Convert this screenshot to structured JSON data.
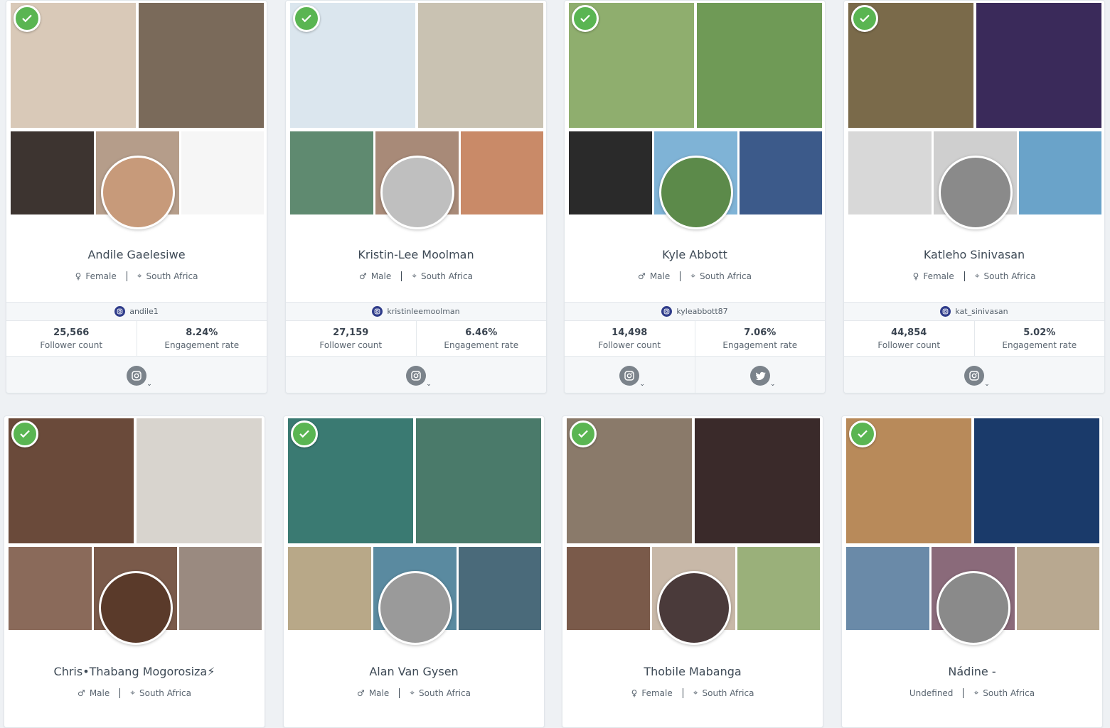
{
  "cards": [
    {
      "name": "Andile Gaelesiwe",
      "gender": "Female",
      "country": "South Africa",
      "handle": "andile1",
      "followers": "25,566",
      "follower_label": "Follower count",
      "engagement": "8.24%",
      "engagement_label": "Engagement rate",
      "socials": [
        "instagram-icon"
      ],
      "avatar_color": "#c79a7a",
      "photo_colors": [
        "#d9c9b8",
        "#7a6a5a",
        "#3d3430",
        "#b59d8a",
        "#f6f6f6"
      ]
    },
    {
      "name": "Kristin-Lee Moolman",
      "gender": "Male",
      "country": "South Africa",
      "handle": "kristinleemoolman",
      "followers": "27,159",
      "follower_label": "Follower count",
      "engagement": "6.46%",
      "engagement_label": "Engagement rate",
      "socials": [
        "instagram-icon"
      ],
      "avatar_color": "#bfbfbf",
      "photo_colors": [
        "#dbe6ee",
        "#c9c2b2",
        "#5f8a70",
        "#a88a78",
        "#c98a68"
      ]
    },
    {
      "name": "Kyle Abbott",
      "gender": "Male",
      "country": "South Africa",
      "handle": "kyleabbott87",
      "followers": "14,498",
      "follower_label": "Follower count",
      "engagement": "7.06%",
      "engagement_label": "Engagement rate",
      "socials": [
        "instagram-icon",
        "twitter-icon"
      ],
      "avatar_color": "#5c8a4a",
      "photo_colors": [
        "#8fae6e",
        "#6f9a56",
        "#2a2a2a",
        "#7fb3d6",
        "#3c5a8a"
      ]
    },
    {
      "name": "Katleho Sinivasan",
      "gender": "Female",
      "country": "South Africa",
      "handle": "kat_sinivasan",
      "followers": "44,854",
      "follower_label": "Follower count",
      "engagement": "5.02%",
      "engagement_label": "Engagement rate",
      "socials": [
        "instagram-icon"
      ],
      "avatar_color": "#8a8a8a",
      "photo_colors": [
        "#7a6a4a",
        "#3a2a5a",
        "#d8d8d8",
        "#cfcfcf",
        "#6aa3c9"
      ]
    },
    {
      "name": "Chris•Thabang Mogorosiza⚡",
      "gender": "Male",
      "country": "South Africa",
      "avatar_color": "#5a3a2a",
      "photo_colors": [
        "#6a4a3a",
        "#d8d4ce",
        "#8a6a5a",
        "#7a5a4a",
        "#9a8a80"
      ]
    },
    {
      "name": "Alan Van Gysen",
      "gender": "Male",
      "country": "South Africa",
      "avatar_color": "#9a9a9a",
      "photo_colors": [
        "#3a7a72",
        "#4a7a6a",
        "#b8a888",
        "#5a8aa0",
        "#4a6a7a"
      ]
    },
    {
      "name": "Thobile Mabanga",
      "gender": "Female",
      "country": "South Africa",
      "avatar_color": "#4a3a3a",
      "photo_colors": [
        "#8a7a6a",
        "#3a2a2a",
        "#7a5a4a",
        "#c8b8a8",
        "#9ab07a"
      ]
    },
    {
      "name": "Nádine -",
      "gender": "Undefined",
      "country": "South Africa",
      "avatar_color": "#8a8a8a",
      "photo_colors": [
        "#b88a5a",
        "#1a3a6a",
        "#6a8aa8",
        "#8a6a7a",
        "#b8a890"
      ]
    }
  ],
  "colors": {
    "verified": "#5ab552",
    "instagram_mini": "#2f3c8a",
    "social_icon": "#7b838b"
  }
}
